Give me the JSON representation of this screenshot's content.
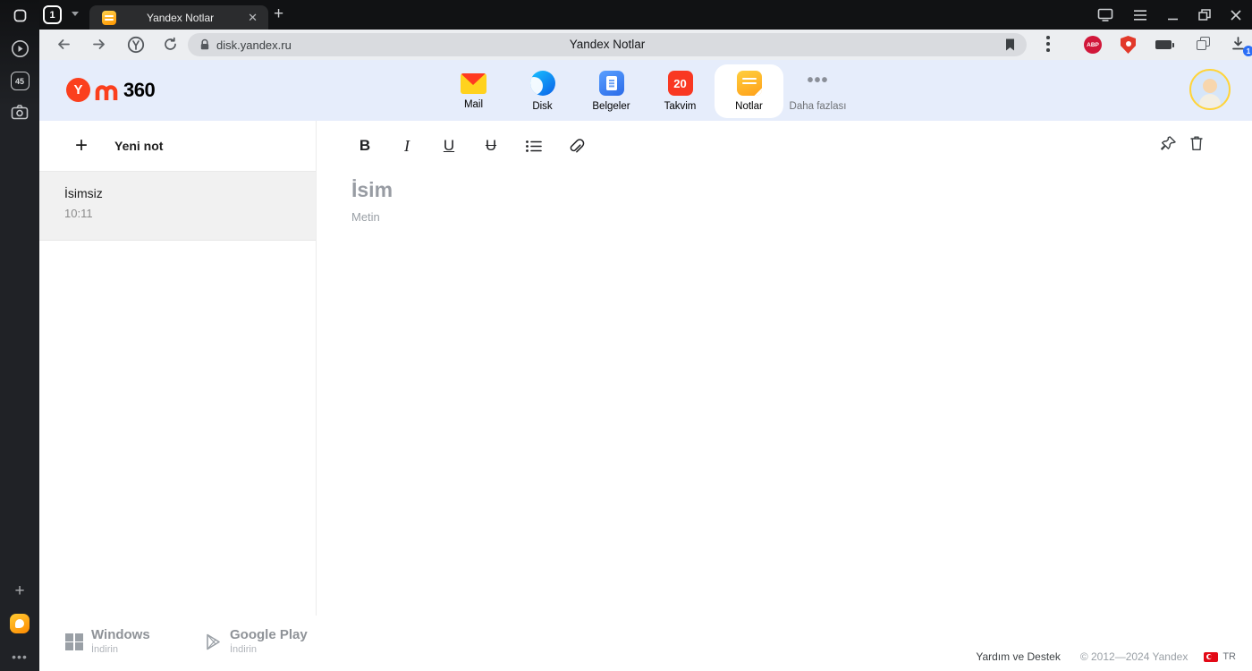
{
  "titlebar": {
    "tab_group_count": "1",
    "tab_title": "Yandex Notlar"
  },
  "toolbar": {
    "url": "disk.yandex.ru",
    "page_title": "Yandex Notlar",
    "abp_label": "ABP",
    "download_badge": "1"
  },
  "rail": {
    "tab_count": "45"
  },
  "header": {
    "logo_text": "360",
    "apps": [
      {
        "label": "Mail"
      },
      {
        "label": "Disk"
      },
      {
        "label": "Belgeler"
      },
      {
        "label": "Takvim",
        "badge": "20"
      },
      {
        "label": "Notlar"
      },
      {
        "label": "Daha fazlası"
      }
    ]
  },
  "notes_panel": {
    "new_note_label": "Yeni not",
    "items": [
      {
        "title": "İsimsiz",
        "time": "10:11"
      }
    ]
  },
  "editor": {
    "toolbar": {
      "bold": "B",
      "italic": "I",
      "underline": "U",
      "strikethrough": "U"
    },
    "title_placeholder": "İsim",
    "body_placeholder": "Metin"
  },
  "footer": {
    "windows_title": "Windows",
    "windows_subtitle": "İndirin",
    "gplay_title": "Google Play",
    "gplay_subtitle": "İndirin",
    "help_label": "Yardım ve Destek",
    "copyright": "© 2012—2024 Yandex",
    "lang_label": "TR"
  }
}
